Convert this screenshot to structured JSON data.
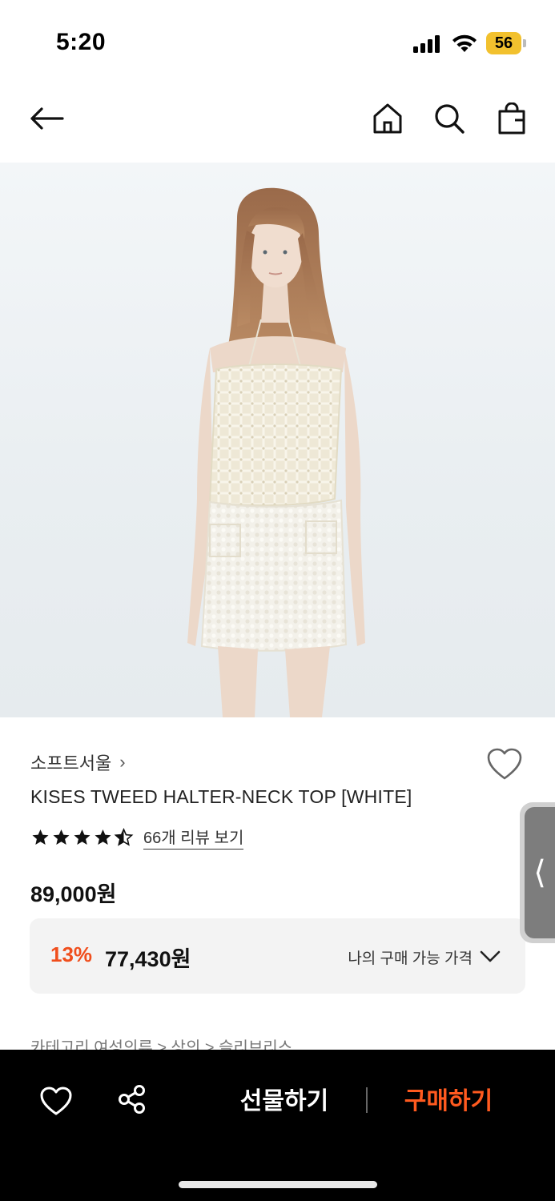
{
  "status_bar": {
    "time": "5:20",
    "battery_level": "56",
    "battery_color": "#f2c12e"
  },
  "header": {
    "icons": [
      "back-arrow-icon",
      "home-icon",
      "search-icon",
      "shopping-bag-icon"
    ]
  },
  "hero": {
    "image": "product-photo"
  },
  "product": {
    "brand": "소프트서울",
    "brand_chevron": "›",
    "name": "KISES TWEED HALTER-NECK TOP [WHITE]",
    "rating": 4.5,
    "review_link": "66개 리뷰 보기",
    "original_price": "89,000원",
    "discount": "13%",
    "sale_price": "77,430원",
    "my_price_label": "나의 구매 가능 가격",
    "category_peek": "카테고리        여성의류 > 상의 > 슬리브리스"
  },
  "side_tab": {
    "glyph": "⟨"
  },
  "bottom_bar": {
    "gift_label": "선물하기",
    "buy_label": "구매하기",
    "accent_color": "#ff5a1f"
  },
  "colors": {
    "discount": "#f04e1c",
    "price_box_bg": "#f3f3f3",
    "bottom_bar_bg": "#000000"
  }
}
